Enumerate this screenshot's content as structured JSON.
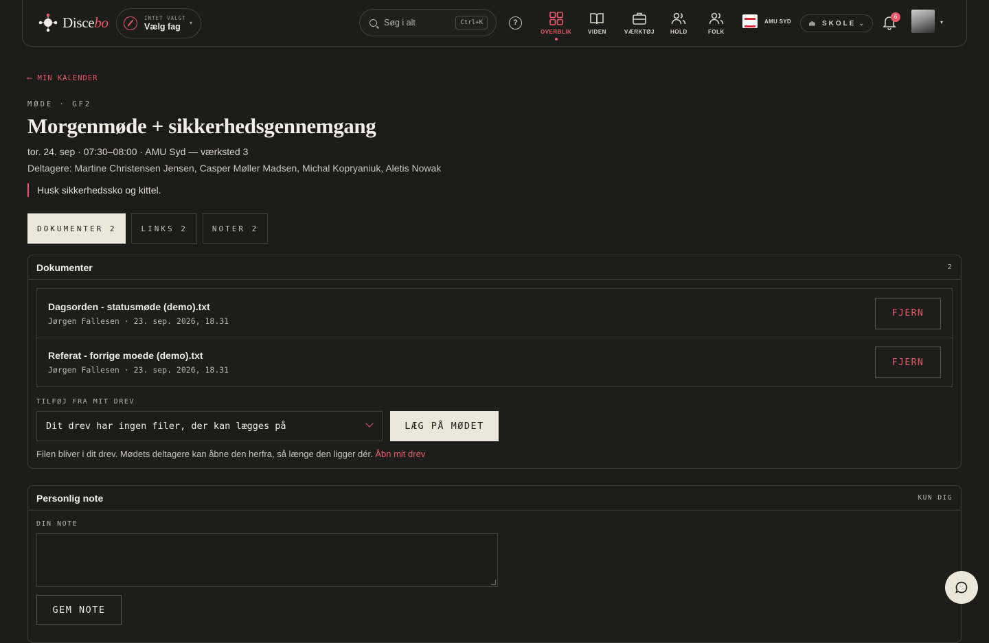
{
  "header": {
    "logo": {
      "text_main": "Disce",
      "text_accent": "bo"
    },
    "subject": {
      "small": "INTET VALGT",
      "big": "Vælg fag"
    },
    "search": {
      "placeholder": "Søg i alt",
      "shortcut": "Ctrl+K"
    },
    "help_icon": "?",
    "nav": [
      {
        "label": "OVERBLIK",
        "icon": "grid-icon",
        "active": true
      },
      {
        "label": "VIDEN",
        "icon": "book-icon",
        "active": false
      },
      {
        "label": "VÆRKTØJ",
        "icon": "briefcase-icon",
        "active": false
      },
      {
        "label": "HOLD",
        "icon": "users-icon",
        "active": false
      },
      {
        "label": "FOLK",
        "icon": "people-icon",
        "active": false
      }
    ],
    "org": {
      "name": "AMU SYD"
    },
    "school": {
      "label": "SKOLE"
    },
    "notifications": {
      "count": "6"
    }
  },
  "page": {
    "back": "⟵  MIN KALENDER",
    "eyebrow": "MØDE · GF2",
    "title": "Morgenmøde + sikkerhedsgennemgang",
    "meta": "tor. 24. sep · 07:30–08:00 · AMU Syd — værksted 3",
    "participants": "Deltagere: Martine Christensen Jensen, Casper Møller Madsen, Michal Kopryaniuk, Aletis Nowak",
    "reminder": "Husk sikkerhedssko og kittel."
  },
  "tabs": [
    {
      "label": "DOKUMENTER 2",
      "active": true
    },
    {
      "label": "LINKS 2",
      "active": false
    },
    {
      "label": "NOTER 2",
      "active": false
    }
  ],
  "documents": {
    "heading": "Dokumenter",
    "count": "2",
    "items": [
      {
        "name": "Dagsorden - statusmøde (demo).txt",
        "sub": "Jørgen Fallesen · 23. sep. 2026, 18.31",
        "action": "FJERN"
      },
      {
        "name": "Referat - forrige moede (demo).txt",
        "sub": "Jørgen Fallesen · 23. sep. 2026, 18.31",
        "action": "FJERN"
      }
    ],
    "add_label": "TILFØJ FRA MIT DREV",
    "select_value": "Dit drev har ingen filer, der kan lægges på",
    "add_button": "LÆG PÅ MØDET",
    "hint": "Filen bliver i dit drev. Mødets deltagere kan åbne den herfra, så længe den ligger dér.",
    "hint_link": "Åbn mit drev"
  },
  "note": {
    "heading": "Personlig note",
    "scope": "KUN DIG",
    "field_label": "DIN NOTE",
    "value": "",
    "save_button": "GEM NOTE"
  },
  "colors": {
    "accent": "#e85a6b",
    "background": "#1b1c18",
    "surface": "#ece7da"
  }
}
